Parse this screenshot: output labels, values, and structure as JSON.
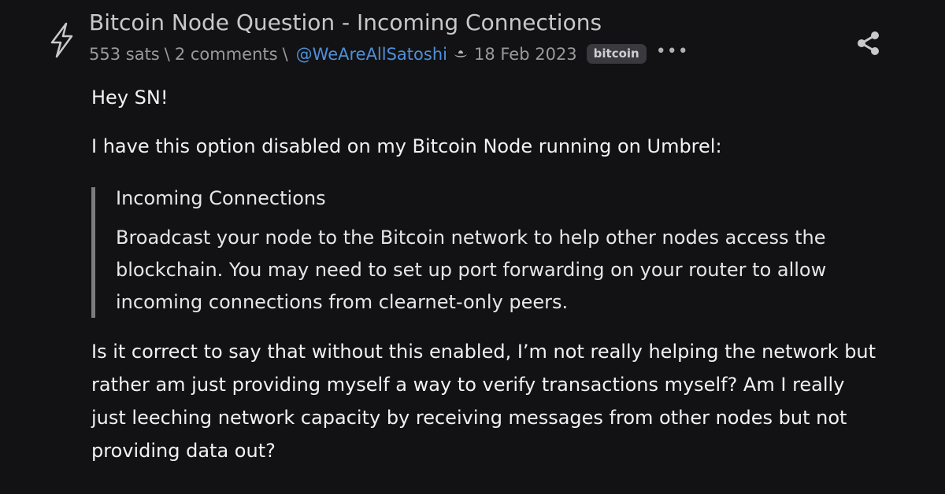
{
  "post": {
    "title": "Bitcoin Node Question - Incoming Connections",
    "meta": {
      "sats": "553 sats",
      "separator": "\\",
      "comments": "2 comments",
      "author": "@WeAreAllSatoshi",
      "date": "18 Feb 2023",
      "tag": "bitcoin",
      "more": "•••"
    },
    "body": {
      "greeting": "Hey SN!",
      "intro": "I have this option disabled on my Bitcoin Node running on Umbrel:",
      "quote_title": "Incoming Connections",
      "quote_body": "Broadcast your node to the Bitcoin network to help other nodes access the blockchain. You may need to set up port forwarding on your router to allow incoming connections from clearnet-only peers.",
      "question": "Is it correct to say that without this enabled, I’m not really helping the network but rather am just providing myself a way to verify transactions myself? Am I really just leeching network capacity by receiving messages from other nodes but not providing data out?"
    }
  },
  "icons": {
    "logo": "lightning-bolt-icon",
    "badge": "cowboy-hat-icon",
    "share": "share-icon"
  },
  "colors": {
    "background": "#121214",
    "author_link": "#4f8fd8",
    "tag_background": "#3a3a3e"
  }
}
